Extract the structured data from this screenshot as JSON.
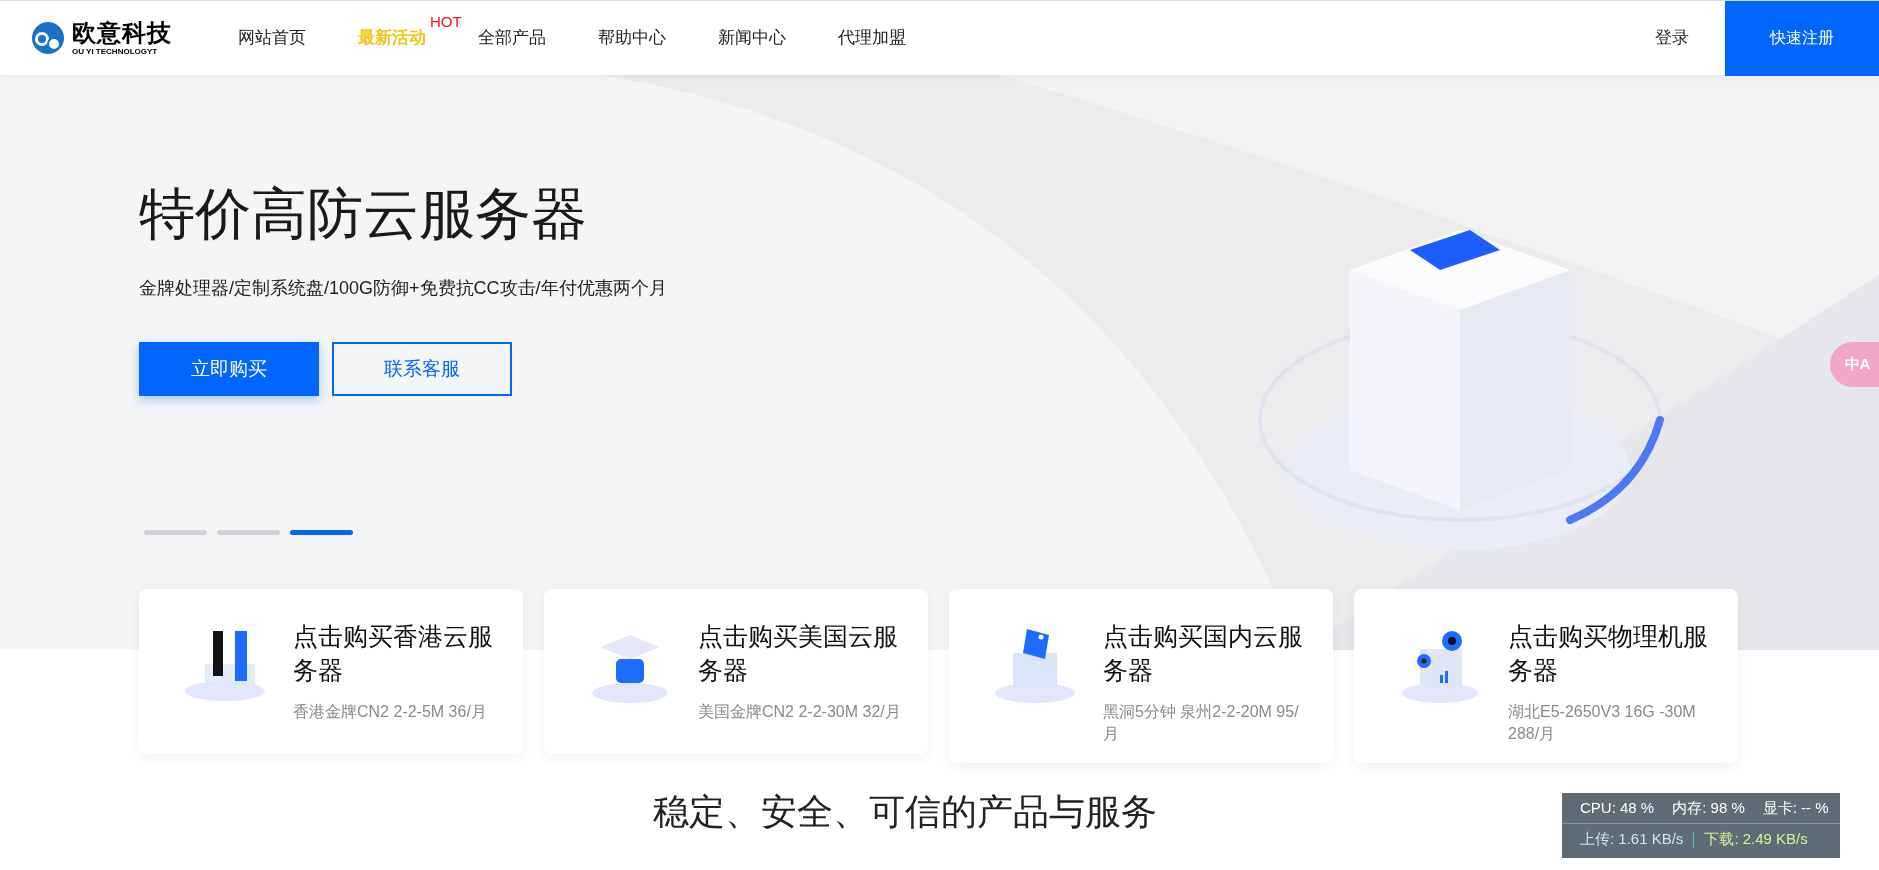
{
  "header": {
    "logo": {
      "name": "欧意科技",
      "tagline": "OU YI TECHNOLOGYT"
    },
    "nav": [
      {
        "label": "网站首页",
        "selected": false
      },
      {
        "label": "最新活动",
        "selected": true,
        "badge": "HOT"
      },
      {
        "label": "全部产品",
        "selected": false
      },
      {
        "label": "帮助中心",
        "selected": false
      },
      {
        "label": "新闻中心",
        "selected": false
      },
      {
        "label": "代理加盟",
        "selected": false
      }
    ],
    "login": "登录",
    "register": "快速注册"
  },
  "hero": {
    "title": "特价高防云服务器",
    "subtitle": "金牌处理器/定制系统盘/100G防御+免费抗CC攻击/年付优惠两个月",
    "primary_button": "立即购买",
    "secondary_button": "联系客服",
    "slides": [
      {
        "selected": false
      },
      {
        "selected": false
      },
      {
        "selected": true
      }
    ]
  },
  "translate_button": "中A",
  "cards": [
    {
      "title": "点击购买香港云服务器",
      "subtitle": "香港金牌CN2 2-2-5M 36/月"
    },
    {
      "title": "点击购买美国云服务器",
      "subtitle": "美国金牌CN2 2-2-30M 32/月"
    },
    {
      "title": "点击购买国内云服务器",
      "subtitle": "黑洞5分钟 泉州2-2-20M 95/月"
    },
    {
      "title": "点击购买物理机服务器",
      "subtitle": "湖北E5-2650V3 16G -30M 288/月"
    }
  ],
  "section_title": "稳定、安全、可信的产品与服务",
  "monitor": {
    "cpu": "CPU: 48 %",
    "memory": "内存: 98 %",
    "gpu": "显卡: -- %",
    "upload": "上传: 1.61 KB/s",
    "download": "下载: 2.49 KB/s"
  }
}
